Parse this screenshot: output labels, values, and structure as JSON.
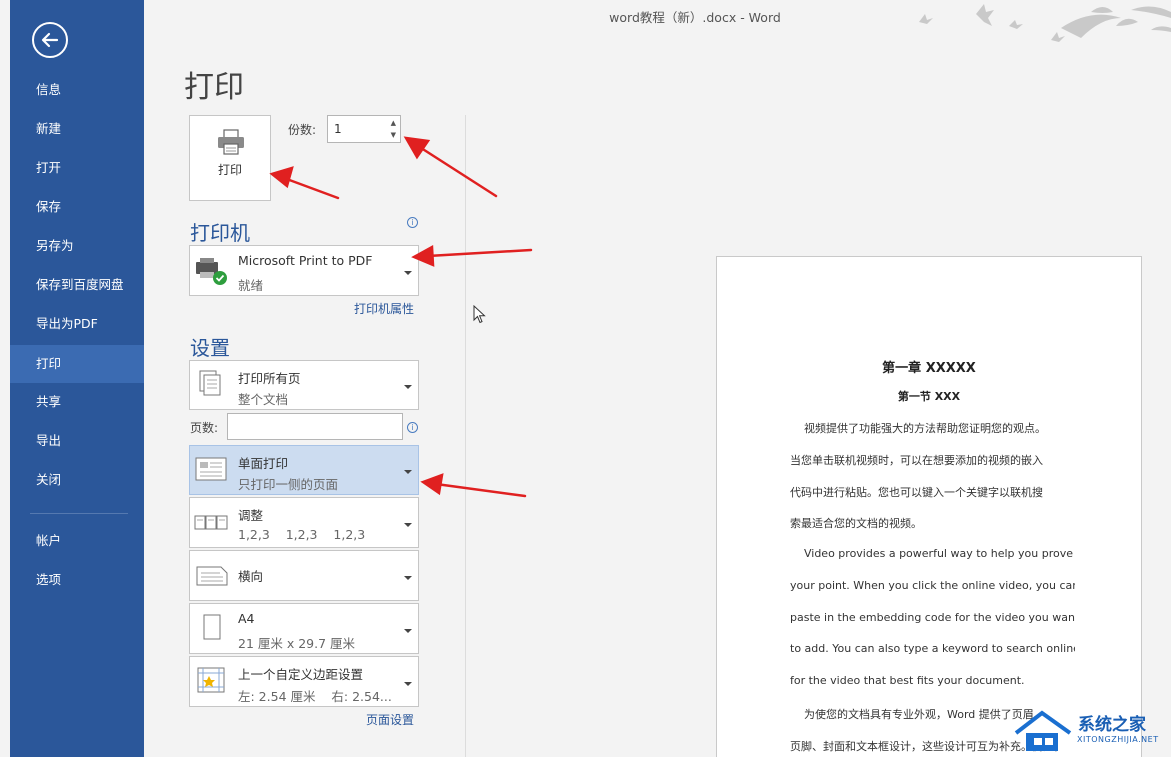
{
  "window_title": "word教程（新）.docx - Word",
  "sidebar": {
    "items": [
      {
        "label": "信息"
      },
      {
        "label": "新建"
      },
      {
        "label": "打开"
      },
      {
        "label": "保存"
      },
      {
        "label": "另存为"
      },
      {
        "label": "保存到百度网盘"
      },
      {
        "label": "导出为PDF"
      },
      {
        "label": "打印",
        "active": true
      },
      {
        "label": "共享"
      },
      {
        "label": "导出"
      },
      {
        "label": "关闭"
      },
      {
        "label": "帐户"
      },
      {
        "label": "选项"
      }
    ]
  },
  "page_title": "打印",
  "print_button": {
    "label": "打印"
  },
  "copies": {
    "label": "份数:",
    "value": "1"
  },
  "printer": {
    "heading": "打印机",
    "name": "Microsoft Print to PDF",
    "status": "就绪",
    "properties_link": "打印机属性"
  },
  "settings": {
    "heading": "设置",
    "print_range": {
      "title": "打印所有页",
      "subtitle": "整个文档"
    },
    "pages_label": "页数:",
    "pages_value": "",
    "sides": {
      "title": "单面打印",
      "subtitle": "只打印一侧的页面"
    },
    "collate": {
      "title": "调整",
      "subtitle": "1,2,3    1,2,3    1,2,3"
    },
    "orientation": {
      "title": "横向"
    },
    "paper": {
      "title": "A4",
      "subtitle": "21 厘米 x 29.7 厘米"
    },
    "margins": {
      "title": "上一个自定义边距设置",
      "subtitle": "左: 2.54 厘米    右: 2.54..."
    },
    "page_setup_link": "页面设置"
  },
  "preview": {
    "heading1": "第一章  XXXXX",
    "heading2": "第一节  XXX",
    "lines": [
      "    视频提供了功能强大的方法帮助您证明您的观点。",
      "当您单击联机视频时，可以在想要添加的视频的嵌入",
      "代码中进行粘贴。您也可以键入一个关键字以联机搜",
      "索最适合您的文档的视频。",
      "    Video provides a powerful way to help you prove",
      "your point. When you click the online video, you can",
      "paste in the embedding code for the video you want",
      "to add. You can also type a keyword to search online",
      "for the video that best fits your document.",
      "    为使您的文档具有专业外观，Word 提供了页眉、",
      "页脚、封面和文本框设计，这些设计可互为补充。例如，"
    ]
  },
  "watermark": {
    "text": "系统之家",
    "sub": "XITONGZHIJIA.NET"
  },
  "colors": {
    "sidebar": "#2b579a",
    "accent": "#2b579a",
    "selected_setting": "#ccdcf0",
    "arrow": "#e02020"
  }
}
